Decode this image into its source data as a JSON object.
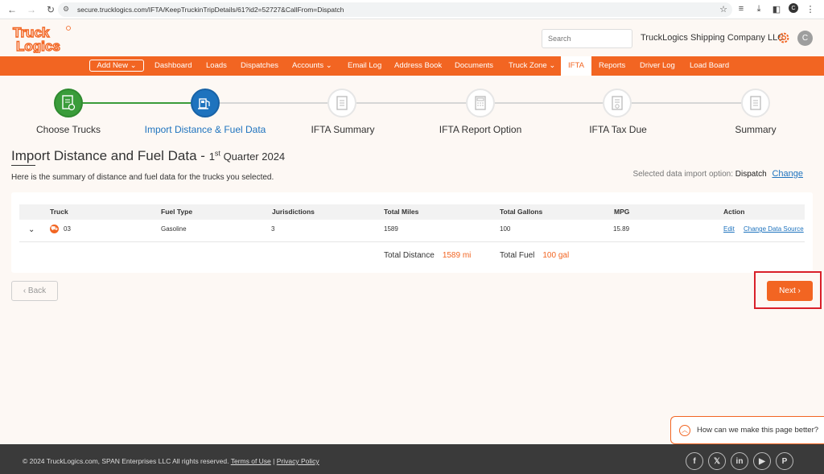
{
  "browser": {
    "url": "secure.trucklogics.com/IFTA/KeepTruckinTripDetails/61?id2=52727&CallFrom=Dispatch",
    "profile_initial": "C"
  },
  "header": {
    "search_placeholder": "Search",
    "company_name": "TruckLogics Shipping Company LLC",
    "avatar_initial": "C",
    "accent_color": "#f26522"
  },
  "nav": {
    "add_new": "Add New",
    "items": [
      "Dashboard",
      "Loads",
      "Dispatches",
      "Accounts",
      "Email Log",
      "Address Book",
      "Documents",
      "Truck Zone",
      "IFTA",
      "Reports",
      "Driver Log",
      "Load Board"
    ],
    "active": "IFTA"
  },
  "stepper": {
    "steps": [
      {
        "label": "Choose Trucks",
        "state": "done"
      },
      {
        "label": "Import Distance & Fuel Data",
        "state": "current"
      },
      {
        "label": "IFTA Summary",
        "state": "pending"
      },
      {
        "label": "IFTA Report Option",
        "state": "pending"
      },
      {
        "label": "IFTA Tax Due",
        "state": "pending"
      },
      {
        "label": "Summary",
        "state": "pending"
      }
    ]
  },
  "page": {
    "title": "Import Distance and Fuel Data -",
    "quarter_num": "1",
    "quarter_sup": "st",
    "quarter_text": "Quarter 2024",
    "summary": "Here is the summary of distance and fuel data for the trucks you selected.",
    "import_option_label": "Selected data import option:",
    "import_option_value": "Dispatch",
    "change_link": "Change"
  },
  "table": {
    "headers": [
      "Truck",
      "Fuel Type",
      "Jurisdictions",
      "Total Miles",
      "Total Gallons",
      "MPG",
      "Action"
    ],
    "rows": [
      {
        "truck": "03",
        "fuel_type": "Gasoline",
        "jurisdictions": "3",
        "total_miles": "1589",
        "total_gallons": "100",
        "mpg": "15.89",
        "edit": "Edit",
        "change_source": "Change Data Source"
      }
    ],
    "total_distance_label": "Total Distance",
    "total_distance_value": "1589 mi",
    "total_fuel_label": "Total Fuel",
    "total_fuel_value": "100 gal"
  },
  "buttons": {
    "back": "‹ Back",
    "next": "Next ›"
  },
  "feedback": {
    "text": "How can we make this page better?"
  },
  "footer": {
    "copyright": "© 2024 TruckLogics.com, SPAN Enterprises LLC All rights reserved.",
    "terms": "Terms of Use",
    "separator": "|",
    "privacy": "Privacy Policy",
    "socials": [
      "facebook-icon",
      "x-icon",
      "linkedin-icon",
      "youtube-icon",
      "pinterest-icon"
    ]
  }
}
